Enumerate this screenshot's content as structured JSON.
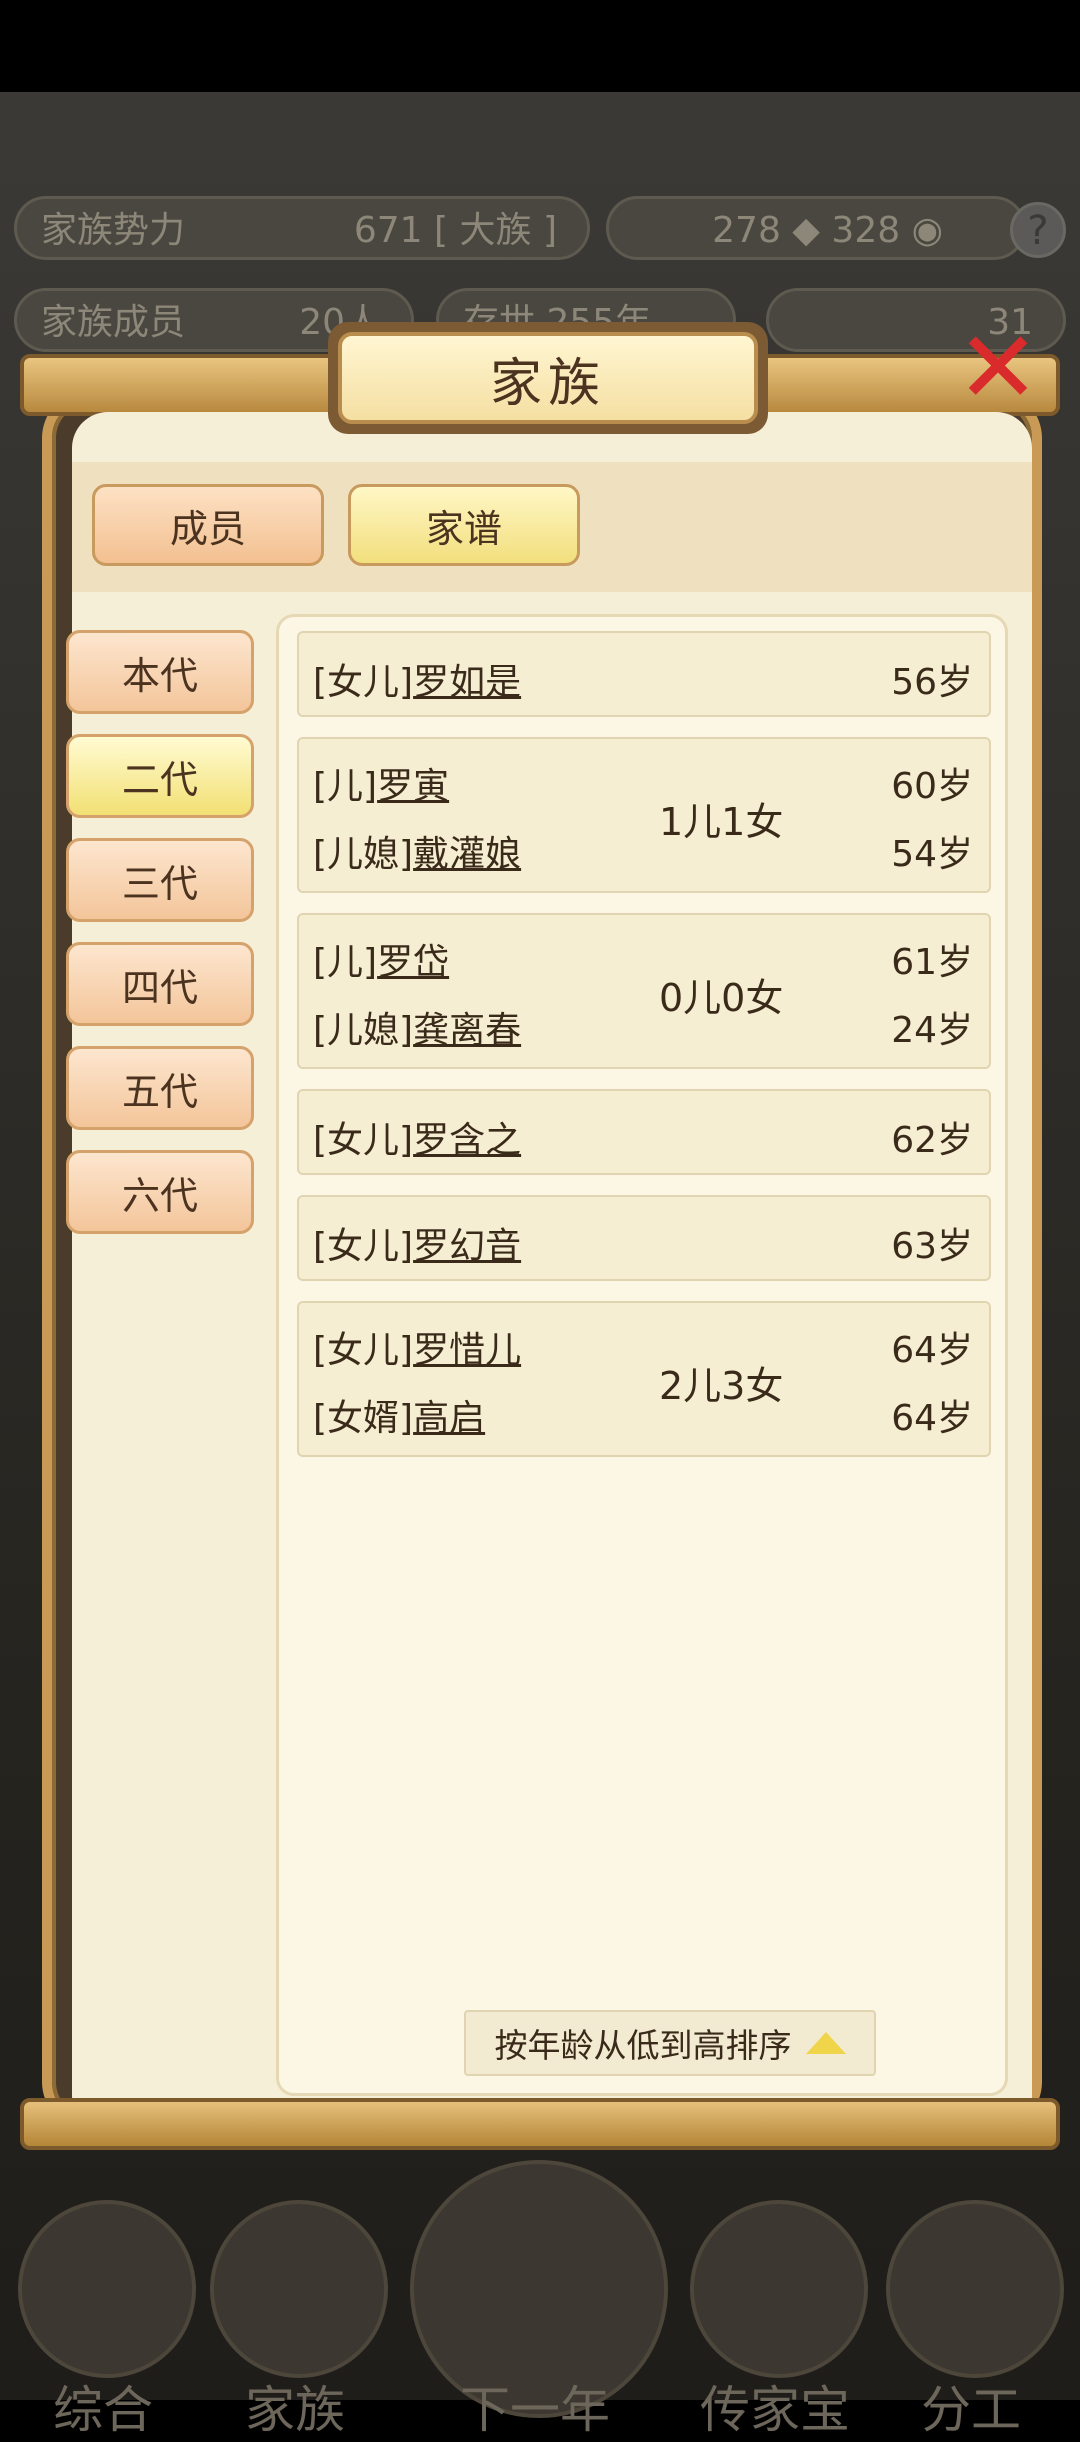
{
  "background": {
    "row1_left_label": "家族势力",
    "row1_left_value": "671 [ 大族 ]",
    "row1_right_value": "278 ◆ 328 ◉",
    "row2_left_label": "家族成员",
    "row2_left_value": "20人",
    "row2_mid": "存世 255年",
    "row2_right_value": "31"
  },
  "dialog": {
    "title": "家族",
    "close_icon": "close-x-icon"
  },
  "tabs": [
    {
      "label": "成员",
      "active": false
    },
    {
      "label": "家谱",
      "active": true
    }
  ],
  "generations": [
    {
      "label": "本代",
      "active": false
    },
    {
      "label": "二代",
      "active": true
    },
    {
      "label": "三代",
      "active": false
    },
    {
      "label": "四代",
      "active": false
    },
    {
      "label": "五代",
      "active": false
    },
    {
      "label": "六代",
      "active": false
    }
  ],
  "family": [
    {
      "type": "single",
      "role": "[女儿]",
      "name": "罗如是",
      "age": "56岁"
    },
    {
      "type": "couple",
      "role": "[儿]",
      "name": "罗寅",
      "age": "60岁",
      "spouse_role": "[儿媳]",
      "spouse_name": "戴灌娘",
      "spouse_age": "54岁",
      "children": "1儿1女"
    },
    {
      "type": "couple",
      "role": "[儿]",
      "name": "罗岱",
      "age": "61岁",
      "spouse_role": "[儿媳]",
      "spouse_name": "龚离春",
      "spouse_age": "24岁",
      "children": "0儿0女"
    },
    {
      "type": "single",
      "role": "[女儿]",
      "name": "罗含之",
      "age": "62岁"
    },
    {
      "type": "single",
      "role": "[女儿]",
      "name": "罗幻音",
      "age": "63岁"
    },
    {
      "type": "couple",
      "role": "[女儿]",
      "name": "罗惜儿",
      "age": "64岁",
      "spouse_role": "[女婿]",
      "spouse_name": "高启",
      "spouse_age": "64岁",
      "children": "2儿3女"
    }
  ],
  "sort": {
    "label": "按年龄从低到高排序"
  },
  "bottom_nav": [
    {
      "label": "综合"
    },
    {
      "label": "家族"
    },
    {
      "label": "下一年"
    },
    {
      "label": "传家宝"
    },
    {
      "label": "分工"
    }
  ]
}
